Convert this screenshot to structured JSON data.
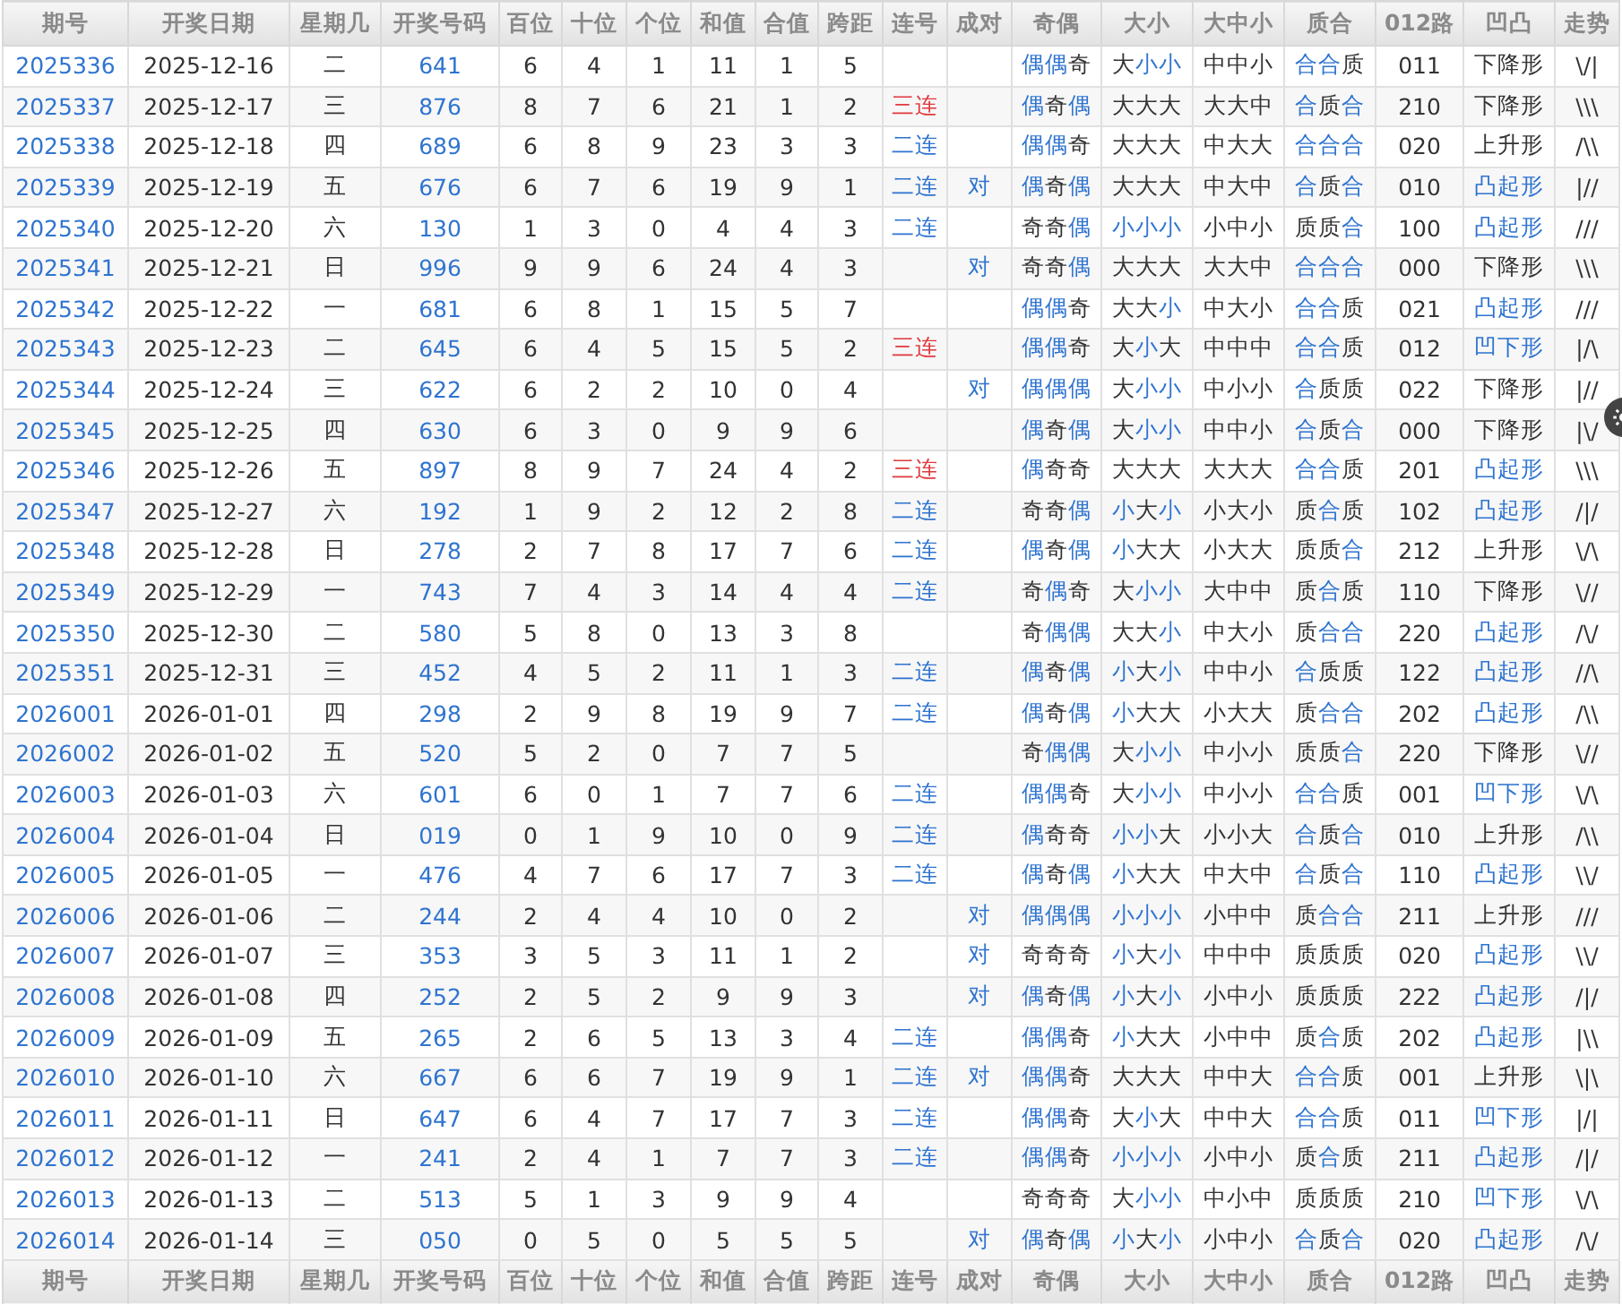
{
  "columns": [
    "期号",
    "开奖日期",
    "星期几",
    "开奖号码",
    "百位",
    "十位",
    "个位",
    "和值",
    "合值",
    "跨距",
    "连号",
    "成对",
    "奇偶",
    "大小",
    "大中小",
    "质合",
    "012路",
    "凹凸",
    "走势"
  ],
  "rows": [
    {
      "period": "2025336",
      "date": "2025-12-16",
      "weekday": "二",
      "number": "641",
      "hundreds": "6",
      "tens": "4",
      "units": "1",
      "sum": "11",
      "sum_tail": "1",
      "span": "5",
      "odd_even": {
        "chars": [
          "偶",
          "偶",
          "奇"
        ],
        "highlighted": [
          true,
          true,
          false
        ]
      },
      "big_small": {
        "chars": [
          "大",
          "小",
          "小"
        ],
        "highlighted": [
          false,
          true,
          true
        ]
      },
      "big_mid_small": "中中小",
      "prime_composite": {
        "chars": [
          "合",
          "合",
          "质"
        ],
        "highlighted": [
          true,
          true,
          false
        ]
      },
      "route": "011",
      "shape": {
        "text": "下降形",
        "highlighted": false
      },
      "trend": "\\/|"
    },
    {
      "period": "2025337",
      "date": "2025-12-17",
      "weekday": "三",
      "number": "876",
      "hundreds": "8",
      "tens": "7",
      "units": "6",
      "sum": "21",
      "sum_tail": "1",
      "span": "2",
      "consecutive": {
        "text": "三连",
        "color": "#e0393e"
      },
      "odd_even": {
        "chars": [
          "偶",
          "奇",
          "偶"
        ],
        "highlighted": [
          true,
          false,
          true
        ]
      },
      "big_small": {
        "chars": [
          "大",
          "大",
          "大"
        ],
        "highlighted": [
          false,
          false,
          false
        ]
      },
      "big_mid_small": "大大中",
      "prime_composite": {
        "chars": [
          "合",
          "质",
          "合"
        ],
        "highlighted": [
          true,
          false,
          true
        ]
      },
      "route": "210",
      "shape": {
        "text": "下降形",
        "highlighted": false
      },
      "trend": "\\\\\\"
    },
    {
      "period": "2025338",
      "date": "2025-12-18",
      "weekday": "四",
      "number": "689",
      "hundreds": "6",
      "tens": "8",
      "units": "9",
      "sum": "23",
      "sum_tail": "3",
      "span": "3",
      "consecutive": {
        "text": "二连",
        "color": "#2f74d0"
      },
      "odd_even": {
        "chars": [
          "偶",
          "偶",
          "奇"
        ],
        "highlighted": [
          true,
          true,
          false
        ]
      },
      "big_small": {
        "chars": [
          "大",
          "大",
          "大"
        ],
        "highlighted": [
          false,
          false,
          false
        ]
      },
      "big_mid_small": "中大大",
      "prime_composite": {
        "chars": [
          "合",
          "合",
          "合"
        ],
        "highlighted": [
          true,
          true,
          true
        ]
      },
      "route": "020",
      "shape": {
        "text": "上升形",
        "highlighted": false
      },
      "trend": "/\\\\"
    },
    {
      "period": "2025339",
      "date": "2025-12-19",
      "weekday": "五",
      "number": "676",
      "hundreds": "6",
      "tens": "7",
      "units": "6",
      "sum": "19",
      "sum_tail": "9",
      "span": "1",
      "consecutive": {
        "text": "二连",
        "color": "#2f74d0"
      },
      "pair": "对",
      "odd_even": {
        "chars": [
          "偶",
          "奇",
          "偶"
        ],
        "highlighted": [
          true,
          false,
          true
        ]
      },
      "big_small": {
        "chars": [
          "大",
          "大",
          "大"
        ],
        "highlighted": [
          false,
          false,
          false
        ]
      },
      "big_mid_small": "中大中",
      "prime_composite": {
        "chars": [
          "合",
          "质",
          "合"
        ],
        "highlighted": [
          true,
          false,
          true
        ]
      },
      "route": "010",
      "shape": {
        "text": "凸起形",
        "highlighted": true
      },
      "trend": "|//"
    },
    {
      "period": "2025340",
      "date": "2025-12-20",
      "weekday": "六",
      "number": "130",
      "hundreds": "1",
      "tens": "3",
      "units": "0",
      "sum": "4",
      "sum_tail": "4",
      "span": "3",
      "consecutive": {
        "text": "二连",
        "color": "#2f74d0"
      },
      "odd_even": {
        "chars": [
          "奇",
          "奇",
          "偶"
        ],
        "highlighted": [
          false,
          false,
          true
        ]
      },
      "big_small": {
        "chars": [
          "小",
          "小",
          "小"
        ],
        "highlighted": [
          true,
          true,
          true
        ]
      },
      "big_mid_small": "小中小",
      "prime_composite": {
        "chars": [
          "质",
          "质",
          "合"
        ],
        "highlighted": [
          false,
          false,
          true
        ]
      },
      "route": "100",
      "shape": {
        "text": "凸起形",
        "highlighted": true
      },
      "trend": "///"
    },
    {
      "period": "2025341",
      "date": "2025-12-21",
      "weekday": "日",
      "number": "996",
      "hundreds": "9",
      "tens": "9",
      "units": "6",
      "sum": "24",
      "sum_tail": "4",
      "span": "3",
      "pair": "对",
      "odd_even": {
        "chars": [
          "奇",
          "奇",
          "偶"
        ],
        "highlighted": [
          false,
          false,
          true
        ]
      },
      "big_small": {
        "chars": [
          "大",
          "大",
          "大"
        ],
        "highlighted": [
          false,
          false,
          false
        ]
      },
      "big_mid_small": "大大中",
      "prime_composite": {
        "chars": [
          "合",
          "合",
          "合"
        ],
        "highlighted": [
          true,
          true,
          true
        ]
      },
      "route": "000",
      "shape": {
        "text": "下降形",
        "highlighted": false
      },
      "trend": "\\\\\\"
    },
    {
      "period": "2025342",
      "date": "2025-12-22",
      "weekday": "一",
      "number": "681",
      "hundreds": "6",
      "tens": "8",
      "units": "1",
      "sum": "15",
      "sum_tail": "5",
      "span": "7",
      "odd_even": {
        "chars": [
          "偶",
          "偶",
          "奇"
        ],
        "highlighted": [
          true,
          true,
          false
        ]
      },
      "big_small": {
        "chars": [
          "大",
          "大",
          "小"
        ],
        "highlighted": [
          false,
          false,
          true
        ]
      },
      "big_mid_small": "中大小",
      "prime_composite": {
        "chars": [
          "合",
          "合",
          "质"
        ],
        "highlighted": [
          true,
          true,
          false
        ]
      },
      "route": "021",
      "shape": {
        "text": "凸起形",
        "highlighted": true
      },
      "trend": "///"
    },
    {
      "period": "2025343",
      "date": "2025-12-23",
      "weekday": "二",
      "number": "645",
      "hundreds": "6",
      "tens": "4",
      "units": "5",
      "sum": "15",
      "sum_tail": "5",
      "span": "2",
      "consecutive": {
        "text": "三连",
        "color": "#e0393e"
      },
      "odd_even": {
        "chars": [
          "偶",
          "偶",
          "奇"
        ],
        "highlighted": [
          true,
          true,
          false
        ]
      },
      "big_small": {
        "chars": [
          "大",
          "小",
          "大"
        ],
        "highlighted": [
          false,
          true,
          false
        ]
      },
      "big_mid_small": "中中中",
      "prime_composite": {
        "chars": [
          "合",
          "合",
          "质"
        ],
        "highlighted": [
          true,
          true,
          false
        ]
      },
      "route": "012",
      "shape": {
        "text": "凹下形",
        "highlighted": true
      },
      "trend": "|/\\"
    },
    {
      "period": "2025344",
      "date": "2025-12-24",
      "weekday": "三",
      "number": "622",
      "hundreds": "6",
      "tens": "2",
      "units": "2",
      "sum": "10",
      "sum_tail": "0",
      "span": "4",
      "pair": "对",
      "odd_even": {
        "chars": [
          "偶",
          "偶",
          "偶"
        ],
        "highlighted": [
          true,
          true,
          true
        ]
      },
      "big_small": {
        "chars": [
          "大",
          "小",
          "小"
        ],
        "highlighted": [
          false,
          true,
          true
        ]
      },
      "big_mid_small": "中小小",
      "prime_composite": {
        "chars": [
          "合",
          "质",
          "质"
        ],
        "highlighted": [
          true,
          false,
          false
        ]
      },
      "route": "022",
      "shape": {
        "text": "下降形",
        "highlighted": false
      },
      "trend": "|//"
    },
    {
      "period": "2025345",
      "date": "2025-12-25",
      "weekday": "四",
      "number": "630",
      "hundreds": "6",
      "tens": "3",
      "units": "0",
      "sum": "9",
      "sum_tail": "9",
      "span": "6",
      "odd_even": {
        "chars": [
          "偶",
          "奇",
          "偶"
        ],
        "highlighted": [
          true,
          false,
          true
        ]
      },
      "big_small": {
        "chars": [
          "大",
          "小",
          "小"
        ],
        "highlighted": [
          false,
          true,
          true
        ]
      },
      "big_mid_small": "中中小",
      "prime_composite": {
        "chars": [
          "合",
          "质",
          "合"
        ],
        "highlighted": [
          true,
          false,
          true
        ]
      },
      "route": "000",
      "shape": {
        "text": "下降形",
        "highlighted": false
      },
      "trend": "|\\/"
    },
    {
      "period": "2025346",
      "date": "2025-12-26",
      "weekday": "五",
      "number": "897",
      "hundreds": "8",
      "tens": "9",
      "units": "7",
      "sum": "24",
      "sum_tail": "4",
      "span": "2",
      "consecutive": {
        "text": "三连",
        "color": "#e0393e"
      },
      "odd_even": {
        "chars": [
          "偶",
          "奇",
          "奇"
        ],
        "highlighted": [
          true,
          false,
          false
        ]
      },
      "big_small": {
        "chars": [
          "大",
          "大",
          "大"
        ],
        "highlighted": [
          false,
          false,
          false
        ]
      },
      "big_mid_small": "大大大",
      "prime_composite": {
        "chars": [
          "合",
          "合",
          "质"
        ],
        "highlighted": [
          true,
          true,
          false
        ]
      },
      "route": "201",
      "shape": {
        "text": "凸起形",
        "highlighted": true
      },
      "trend": "\\\\\\"
    },
    {
      "period": "2025347",
      "date": "2025-12-27",
      "weekday": "六",
      "number": "192",
      "hundreds": "1",
      "tens": "9",
      "units": "2",
      "sum": "12",
      "sum_tail": "2",
      "span": "8",
      "consecutive": {
        "text": "二连",
        "color": "#2f74d0"
      },
      "odd_even": {
        "chars": [
          "奇",
          "奇",
          "偶"
        ],
        "highlighted": [
          false,
          false,
          true
        ]
      },
      "big_small": {
        "chars": [
          "小",
          "大",
          "小"
        ],
        "highlighted": [
          true,
          false,
          true
        ]
      },
      "big_mid_small": "小大小",
      "prime_composite": {
        "chars": [
          "质",
          "合",
          "质"
        ],
        "highlighted": [
          false,
          true,
          false
        ]
      },
      "route": "102",
      "shape": {
        "text": "凸起形",
        "highlighted": true
      },
      "trend": "/|/"
    },
    {
      "period": "2025348",
      "date": "2025-12-28",
      "weekday": "日",
      "number": "278",
      "hundreds": "2",
      "tens": "7",
      "units": "8",
      "sum": "17",
      "sum_tail": "7",
      "span": "6",
      "consecutive": {
        "text": "二连",
        "color": "#2f74d0"
      },
      "odd_even": {
        "chars": [
          "偶",
          "奇",
          "偶"
        ],
        "highlighted": [
          true,
          false,
          true
        ]
      },
      "big_small": {
        "chars": [
          "小",
          "大",
          "大"
        ],
        "highlighted": [
          true,
          false,
          false
        ]
      },
      "big_mid_small": "小大大",
      "prime_composite": {
        "chars": [
          "质",
          "质",
          "合"
        ],
        "highlighted": [
          false,
          false,
          true
        ]
      },
      "route": "212",
      "shape": {
        "text": "上升形",
        "highlighted": false
      },
      "trend": "\\/\\"
    },
    {
      "period": "2025349",
      "date": "2025-12-29",
      "weekday": "一",
      "number": "743",
      "hundreds": "7",
      "tens": "4",
      "units": "3",
      "sum": "14",
      "sum_tail": "4",
      "span": "4",
      "consecutive": {
        "text": "二连",
        "color": "#2f74d0"
      },
      "odd_even": {
        "chars": [
          "奇",
          "偶",
          "奇"
        ],
        "highlighted": [
          false,
          true,
          false
        ]
      },
      "big_small": {
        "chars": [
          "大",
          "小",
          "小"
        ],
        "highlighted": [
          false,
          true,
          true
        ]
      },
      "big_mid_small": "大中中",
      "prime_composite": {
        "chars": [
          "质",
          "合",
          "质"
        ],
        "highlighted": [
          false,
          true,
          false
        ]
      },
      "route": "110",
      "shape": {
        "text": "下降形",
        "highlighted": false
      },
      "trend": "\\//"
    },
    {
      "period": "2025350",
      "date": "2025-12-30",
      "weekday": "二",
      "number": "580",
      "hundreds": "5",
      "tens": "8",
      "units": "0",
      "sum": "13",
      "sum_tail": "3",
      "span": "8",
      "odd_even": {
        "chars": [
          "奇",
          "偶",
          "偶"
        ],
        "highlighted": [
          false,
          true,
          true
        ]
      },
      "big_small": {
        "chars": [
          "大",
          "大",
          "小"
        ],
        "highlighted": [
          false,
          false,
          true
        ]
      },
      "big_mid_small": "中大小",
      "prime_composite": {
        "chars": [
          "质",
          "合",
          "合"
        ],
        "highlighted": [
          false,
          true,
          true
        ]
      },
      "route": "220",
      "shape": {
        "text": "凸起形",
        "highlighted": true
      },
      "trend": "/\\/"
    },
    {
      "period": "2025351",
      "date": "2025-12-31",
      "weekday": "三",
      "number": "452",
      "hundreds": "4",
      "tens": "5",
      "units": "2",
      "sum": "11",
      "sum_tail": "1",
      "span": "3",
      "consecutive": {
        "text": "二连",
        "color": "#2f74d0"
      },
      "odd_even": {
        "chars": [
          "偶",
          "奇",
          "偶"
        ],
        "highlighted": [
          true,
          false,
          true
        ]
      },
      "big_small": {
        "chars": [
          "小",
          "大",
          "小"
        ],
        "highlighted": [
          true,
          false,
          true
        ]
      },
      "big_mid_small": "中中小",
      "prime_composite": {
        "chars": [
          "合",
          "质",
          "质"
        ],
        "highlighted": [
          true,
          false,
          false
        ]
      },
      "route": "122",
      "shape": {
        "text": "凸起形",
        "highlighted": true
      },
      "trend": "//\\"
    },
    {
      "period": "2026001",
      "date": "2026-01-01",
      "weekday": "四",
      "number": "298",
      "hundreds": "2",
      "tens": "9",
      "units": "8",
      "sum": "19",
      "sum_tail": "9",
      "span": "7",
      "consecutive": {
        "text": "二连",
        "color": "#2f74d0"
      },
      "odd_even": {
        "chars": [
          "偶",
          "奇",
          "偶"
        ],
        "highlighted": [
          true,
          false,
          true
        ]
      },
      "big_small": {
        "chars": [
          "小",
          "大",
          "大"
        ],
        "highlighted": [
          true,
          false,
          false
        ]
      },
      "big_mid_small": "小大大",
      "prime_composite": {
        "chars": [
          "质",
          "合",
          "合"
        ],
        "highlighted": [
          false,
          true,
          true
        ]
      },
      "route": "202",
      "shape": {
        "text": "凸起形",
        "highlighted": true
      },
      "trend": "/\\\\"
    },
    {
      "period": "2026002",
      "date": "2026-01-02",
      "weekday": "五",
      "number": "520",
      "hundreds": "5",
      "tens": "2",
      "units": "0",
      "sum": "7",
      "sum_tail": "7",
      "span": "5",
      "odd_even": {
        "chars": [
          "奇",
          "偶",
          "偶"
        ],
        "highlighted": [
          false,
          true,
          true
        ]
      },
      "big_small": {
        "chars": [
          "大",
          "小",
          "小"
        ],
        "highlighted": [
          false,
          true,
          true
        ]
      },
      "big_mid_small": "中小小",
      "prime_composite": {
        "chars": [
          "质",
          "质",
          "合"
        ],
        "highlighted": [
          false,
          false,
          true
        ]
      },
      "route": "220",
      "shape": {
        "text": "下降形",
        "highlighted": false
      },
      "trend": "\\//"
    },
    {
      "period": "2026003",
      "date": "2026-01-03",
      "weekday": "六",
      "number": "601",
      "hundreds": "6",
      "tens": "0",
      "units": "1",
      "sum": "7",
      "sum_tail": "7",
      "span": "6",
      "consecutive": {
        "text": "二连",
        "color": "#2f74d0"
      },
      "odd_even": {
        "chars": [
          "偶",
          "偶",
          "奇"
        ],
        "highlighted": [
          true,
          true,
          false
        ]
      },
      "big_small": {
        "chars": [
          "大",
          "小",
          "小"
        ],
        "highlighted": [
          false,
          true,
          true
        ]
      },
      "big_mid_small": "中小小",
      "prime_composite": {
        "chars": [
          "合",
          "合",
          "质"
        ],
        "highlighted": [
          true,
          true,
          false
        ]
      },
      "route": "001",
      "shape": {
        "text": "凹下形",
        "highlighted": true
      },
      "trend": "\\/\\"
    },
    {
      "period": "2026004",
      "date": "2026-01-04",
      "weekday": "日",
      "number": "019",
      "hundreds": "0",
      "tens": "1",
      "units": "9",
      "sum": "10",
      "sum_tail": "0",
      "span": "9",
      "consecutive": {
        "text": "二连",
        "color": "#2f74d0"
      },
      "odd_even": {
        "chars": [
          "偶",
          "奇",
          "奇"
        ],
        "highlighted": [
          true,
          false,
          false
        ]
      },
      "big_small": {
        "chars": [
          "小",
          "小",
          "大"
        ],
        "highlighted": [
          true,
          true,
          false
        ]
      },
      "big_mid_small": "小小大",
      "prime_composite": {
        "chars": [
          "合",
          "质",
          "合"
        ],
        "highlighted": [
          true,
          false,
          true
        ]
      },
      "route": "010",
      "shape": {
        "text": "上升形",
        "highlighted": false
      },
      "trend": "/\\\\"
    },
    {
      "period": "2026005",
      "date": "2026-01-05",
      "weekday": "一",
      "number": "476",
      "hundreds": "4",
      "tens": "7",
      "units": "6",
      "sum": "17",
      "sum_tail": "7",
      "span": "3",
      "consecutive": {
        "text": "二连",
        "color": "#2f74d0"
      },
      "odd_even": {
        "chars": [
          "偶",
          "奇",
          "偶"
        ],
        "highlighted": [
          true,
          false,
          true
        ]
      },
      "big_small": {
        "chars": [
          "小",
          "大",
          "大"
        ],
        "highlighted": [
          true,
          false,
          false
        ]
      },
      "big_mid_small": "中大中",
      "prime_composite": {
        "chars": [
          "合",
          "质",
          "合"
        ],
        "highlighted": [
          true,
          false,
          true
        ]
      },
      "route": "110",
      "shape": {
        "text": "凸起形",
        "highlighted": true
      },
      "trend": "\\\\/"
    },
    {
      "period": "2026006",
      "date": "2026-01-06",
      "weekday": "二",
      "number": "244",
      "hundreds": "2",
      "tens": "4",
      "units": "4",
      "sum": "10",
      "sum_tail": "0",
      "span": "2",
      "pair": "对",
      "odd_even": {
        "chars": [
          "偶",
          "偶",
          "偶"
        ],
        "highlighted": [
          true,
          true,
          true
        ]
      },
      "big_small": {
        "chars": [
          "小",
          "小",
          "小"
        ],
        "highlighted": [
          true,
          true,
          true
        ]
      },
      "big_mid_small": "小中中",
      "prime_composite": {
        "chars": [
          "质",
          "合",
          "合"
        ],
        "highlighted": [
          false,
          true,
          true
        ]
      },
      "route": "211",
      "shape": {
        "text": "上升形",
        "highlighted": false
      },
      "trend": "///"
    },
    {
      "period": "2026007",
      "date": "2026-01-07",
      "weekday": "三",
      "number": "353",
      "hundreds": "3",
      "tens": "5",
      "units": "3",
      "sum": "11",
      "sum_tail": "1",
      "span": "2",
      "pair": "对",
      "odd_even": {
        "chars": [
          "奇",
          "奇",
          "奇"
        ],
        "highlighted": [
          false,
          false,
          false
        ]
      },
      "big_small": {
        "chars": [
          "小",
          "大",
          "小"
        ],
        "highlighted": [
          true,
          false,
          true
        ]
      },
      "big_mid_small": "中中中",
      "prime_composite": {
        "chars": [
          "质",
          "质",
          "质"
        ],
        "highlighted": [
          false,
          false,
          false
        ]
      },
      "route": "020",
      "shape": {
        "text": "凸起形",
        "highlighted": true
      },
      "trend": "\\\\/"
    },
    {
      "period": "2026008",
      "date": "2026-01-08",
      "weekday": "四",
      "number": "252",
      "hundreds": "2",
      "tens": "5",
      "units": "2",
      "sum": "9",
      "sum_tail": "9",
      "span": "3",
      "pair": "对",
      "odd_even": {
        "chars": [
          "偶",
          "奇",
          "偶"
        ],
        "highlighted": [
          true,
          false,
          true
        ]
      },
      "big_small": {
        "chars": [
          "小",
          "大",
          "小"
        ],
        "highlighted": [
          true,
          false,
          true
        ]
      },
      "big_mid_small": "小中小",
      "prime_composite": {
        "chars": [
          "质",
          "质",
          "质"
        ],
        "highlighted": [
          false,
          false,
          false
        ]
      },
      "route": "222",
      "shape": {
        "text": "凸起形",
        "highlighted": true
      },
      "trend": "/|/"
    },
    {
      "period": "2026009",
      "date": "2026-01-09",
      "weekday": "五",
      "number": "265",
      "hundreds": "2",
      "tens": "6",
      "units": "5",
      "sum": "13",
      "sum_tail": "3",
      "span": "4",
      "consecutive": {
        "text": "二连",
        "color": "#2f74d0"
      },
      "odd_even": {
        "chars": [
          "偶",
          "偶",
          "奇"
        ],
        "highlighted": [
          true,
          true,
          false
        ]
      },
      "big_small": {
        "chars": [
          "小",
          "大",
          "大"
        ],
        "highlighted": [
          true,
          false,
          false
        ]
      },
      "big_mid_small": "小中中",
      "prime_composite": {
        "chars": [
          "质",
          "合",
          "质"
        ],
        "highlighted": [
          false,
          true,
          false
        ]
      },
      "route": "202",
      "shape": {
        "text": "凸起形",
        "highlighted": true
      },
      "trend": "|\\\\"
    },
    {
      "period": "2026010",
      "date": "2026-01-10",
      "weekday": "六",
      "number": "667",
      "hundreds": "6",
      "tens": "6",
      "units": "7",
      "sum": "19",
      "sum_tail": "9",
      "span": "1",
      "consecutive": {
        "text": "二连",
        "color": "#2f74d0"
      },
      "pair": "对",
      "odd_even": {
        "chars": [
          "偶",
          "偶",
          "奇"
        ],
        "highlighted": [
          true,
          true,
          false
        ]
      },
      "big_small": {
        "chars": [
          "大",
          "大",
          "大"
        ],
        "highlighted": [
          false,
          false,
          false
        ]
      },
      "big_mid_small": "中中大",
      "prime_composite": {
        "chars": [
          "合",
          "合",
          "质"
        ],
        "highlighted": [
          true,
          true,
          false
        ]
      },
      "route": "001",
      "shape": {
        "text": "上升形",
        "highlighted": false
      },
      "trend": "\\|\\"
    },
    {
      "period": "2026011",
      "date": "2026-01-11",
      "weekday": "日",
      "number": "647",
      "hundreds": "6",
      "tens": "4",
      "units": "7",
      "sum": "17",
      "sum_tail": "7",
      "span": "3",
      "consecutive": {
        "text": "二连",
        "color": "#2f74d0"
      },
      "odd_even": {
        "chars": [
          "偶",
          "偶",
          "奇"
        ],
        "highlighted": [
          true,
          true,
          false
        ]
      },
      "big_small": {
        "chars": [
          "大",
          "小",
          "大"
        ],
        "highlighted": [
          false,
          true,
          false
        ]
      },
      "big_mid_small": "中中大",
      "prime_composite": {
        "chars": [
          "合",
          "合",
          "质"
        ],
        "highlighted": [
          true,
          true,
          false
        ]
      },
      "route": "011",
      "shape": {
        "text": "凹下形",
        "highlighted": true
      },
      "trend": "|/|"
    },
    {
      "period": "2026012",
      "date": "2026-01-12",
      "weekday": "一",
      "number": "241",
      "hundreds": "2",
      "tens": "4",
      "units": "1",
      "sum": "7",
      "sum_tail": "7",
      "span": "3",
      "consecutive": {
        "text": "二连",
        "color": "#2f74d0"
      },
      "odd_even": {
        "chars": [
          "偶",
          "偶",
          "奇"
        ],
        "highlighted": [
          true,
          true,
          false
        ]
      },
      "big_small": {
        "chars": [
          "小",
          "小",
          "小"
        ],
        "highlighted": [
          true,
          true,
          true
        ]
      },
      "big_mid_small": "小中小",
      "prime_composite": {
        "chars": [
          "质",
          "合",
          "质"
        ],
        "highlighted": [
          false,
          true,
          false
        ]
      },
      "route": "211",
      "shape": {
        "text": "凸起形",
        "highlighted": true
      },
      "trend": "/|/"
    },
    {
      "period": "2026013",
      "date": "2026-01-13",
      "weekday": "二",
      "number": "513",
      "hundreds": "5",
      "tens": "1",
      "units": "3",
      "sum": "9",
      "sum_tail": "9",
      "span": "4",
      "odd_even": {
        "chars": [
          "奇",
          "奇",
          "奇"
        ],
        "highlighted": [
          false,
          false,
          false
        ]
      },
      "big_small": {
        "chars": [
          "大",
          "小",
          "小"
        ],
        "highlighted": [
          false,
          true,
          true
        ]
      },
      "big_mid_small": "中小中",
      "prime_composite": {
        "chars": [
          "质",
          "质",
          "质"
        ],
        "highlighted": [
          false,
          false,
          false
        ]
      },
      "route": "210",
      "shape": {
        "text": "凹下形",
        "highlighted": true
      },
      "trend": "\\/\\"
    },
    {
      "period": "2026014",
      "date": "2026-01-14",
      "weekday": "三",
      "number": "050",
      "hundreds": "0",
      "tens": "5",
      "units": "0",
      "sum": "5",
      "sum_tail": "5",
      "span": "5",
      "pair": "对",
      "odd_even": {
        "chars": [
          "偶",
          "奇",
          "偶"
        ],
        "highlighted": [
          true,
          false,
          true
        ]
      },
      "big_small": {
        "chars": [
          "小",
          "大",
          "小"
        ],
        "highlighted": [
          true,
          false,
          true
        ]
      },
      "big_mid_small": "小中小",
      "prime_composite": {
        "chars": [
          "合",
          "质",
          "合"
        ],
        "highlighted": [
          true,
          false,
          true
        ]
      },
      "route": "020",
      "shape": {
        "text": "凸起形",
        "highlighted": true
      },
      "trend": "/\\/"
    }
  ],
  "footer_columns": [
    "期号",
    "开奖日期",
    "星期几",
    "开奖号码",
    "百位",
    "十位",
    "个位",
    "和值",
    "合值",
    "跨距",
    "连号",
    "成对",
    "奇偶",
    "大小",
    "大中小",
    "质合",
    "012路",
    "凹凸",
    "走势"
  ]
}
